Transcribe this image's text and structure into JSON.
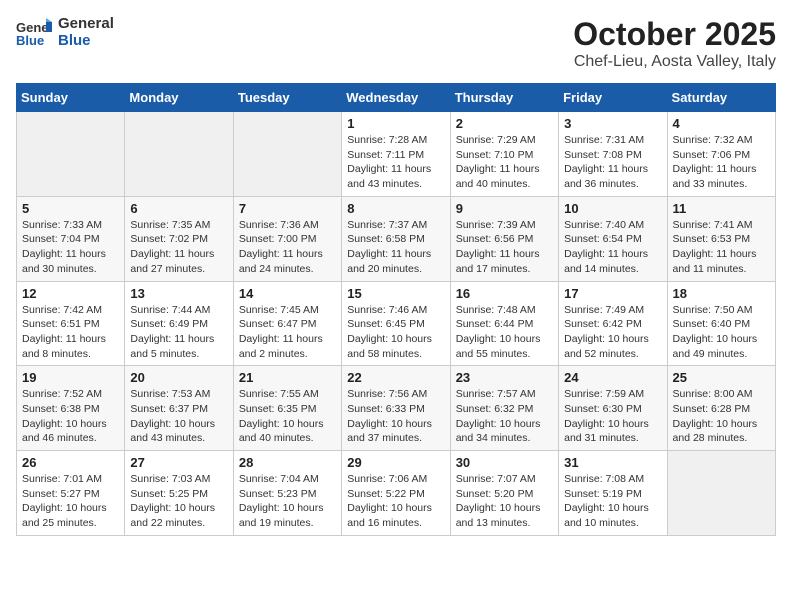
{
  "logo": {
    "line1": "General",
    "line2": "Blue"
  },
  "title": "October 2025",
  "subtitle": "Chef-Lieu, Aosta Valley, Italy",
  "days_of_week": [
    "Sunday",
    "Monday",
    "Tuesday",
    "Wednesday",
    "Thursday",
    "Friday",
    "Saturday"
  ],
  "weeks": [
    [
      {
        "day": "",
        "info": ""
      },
      {
        "day": "",
        "info": ""
      },
      {
        "day": "",
        "info": ""
      },
      {
        "day": "1",
        "info": "Sunrise: 7:28 AM\nSunset: 7:11 PM\nDaylight: 11 hours and 43 minutes."
      },
      {
        "day": "2",
        "info": "Sunrise: 7:29 AM\nSunset: 7:10 PM\nDaylight: 11 hours and 40 minutes."
      },
      {
        "day": "3",
        "info": "Sunrise: 7:31 AM\nSunset: 7:08 PM\nDaylight: 11 hours and 36 minutes."
      },
      {
        "day": "4",
        "info": "Sunrise: 7:32 AM\nSunset: 7:06 PM\nDaylight: 11 hours and 33 minutes."
      }
    ],
    [
      {
        "day": "5",
        "info": "Sunrise: 7:33 AM\nSunset: 7:04 PM\nDaylight: 11 hours and 30 minutes."
      },
      {
        "day": "6",
        "info": "Sunrise: 7:35 AM\nSunset: 7:02 PM\nDaylight: 11 hours and 27 minutes."
      },
      {
        "day": "7",
        "info": "Sunrise: 7:36 AM\nSunset: 7:00 PM\nDaylight: 11 hours and 24 minutes."
      },
      {
        "day": "8",
        "info": "Sunrise: 7:37 AM\nSunset: 6:58 PM\nDaylight: 11 hours and 20 minutes."
      },
      {
        "day": "9",
        "info": "Sunrise: 7:39 AM\nSunset: 6:56 PM\nDaylight: 11 hours and 17 minutes."
      },
      {
        "day": "10",
        "info": "Sunrise: 7:40 AM\nSunset: 6:54 PM\nDaylight: 11 hours and 14 minutes."
      },
      {
        "day": "11",
        "info": "Sunrise: 7:41 AM\nSunset: 6:53 PM\nDaylight: 11 hours and 11 minutes."
      }
    ],
    [
      {
        "day": "12",
        "info": "Sunrise: 7:42 AM\nSunset: 6:51 PM\nDaylight: 11 hours and 8 minutes."
      },
      {
        "day": "13",
        "info": "Sunrise: 7:44 AM\nSunset: 6:49 PM\nDaylight: 11 hours and 5 minutes."
      },
      {
        "day": "14",
        "info": "Sunrise: 7:45 AM\nSunset: 6:47 PM\nDaylight: 11 hours and 2 minutes."
      },
      {
        "day": "15",
        "info": "Sunrise: 7:46 AM\nSunset: 6:45 PM\nDaylight: 10 hours and 58 minutes."
      },
      {
        "day": "16",
        "info": "Sunrise: 7:48 AM\nSunset: 6:44 PM\nDaylight: 10 hours and 55 minutes."
      },
      {
        "day": "17",
        "info": "Sunrise: 7:49 AM\nSunset: 6:42 PM\nDaylight: 10 hours and 52 minutes."
      },
      {
        "day": "18",
        "info": "Sunrise: 7:50 AM\nSunset: 6:40 PM\nDaylight: 10 hours and 49 minutes."
      }
    ],
    [
      {
        "day": "19",
        "info": "Sunrise: 7:52 AM\nSunset: 6:38 PM\nDaylight: 10 hours and 46 minutes."
      },
      {
        "day": "20",
        "info": "Sunrise: 7:53 AM\nSunset: 6:37 PM\nDaylight: 10 hours and 43 minutes."
      },
      {
        "day": "21",
        "info": "Sunrise: 7:55 AM\nSunset: 6:35 PM\nDaylight: 10 hours and 40 minutes."
      },
      {
        "day": "22",
        "info": "Sunrise: 7:56 AM\nSunset: 6:33 PM\nDaylight: 10 hours and 37 minutes."
      },
      {
        "day": "23",
        "info": "Sunrise: 7:57 AM\nSunset: 6:32 PM\nDaylight: 10 hours and 34 minutes."
      },
      {
        "day": "24",
        "info": "Sunrise: 7:59 AM\nSunset: 6:30 PM\nDaylight: 10 hours and 31 minutes."
      },
      {
        "day": "25",
        "info": "Sunrise: 8:00 AM\nSunset: 6:28 PM\nDaylight: 10 hours and 28 minutes."
      }
    ],
    [
      {
        "day": "26",
        "info": "Sunrise: 7:01 AM\nSunset: 5:27 PM\nDaylight: 10 hours and 25 minutes."
      },
      {
        "day": "27",
        "info": "Sunrise: 7:03 AM\nSunset: 5:25 PM\nDaylight: 10 hours and 22 minutes."
      },
      {
        "day": "28",
        "info": "Sunrise: 7:04 AM\nSunset: 5:23 PM\nDaylight: 10 hours and 19 minutes."
      },
      {
        "day": "29",
        "info": "Sunrise: 7:06 AM\nSunset: 5:22 PM\nDaylight: 10 hours and 16 minutes."
      },
      {
        "day": "30",
        "info": "Sunrise: 7:07 AM\nSunset: 5:20 PM\nDaylight: 10 hours and 13 minutes."
      },
      {
        "day": "31",
        "info": "Sunrise: 7:08 AM\nSunset: 5:19 PM\nDaylight: 10 hours and 10 minutes."
      },
      {
        "day": "",
        "info": ""
      }
    ]
  ]
}
